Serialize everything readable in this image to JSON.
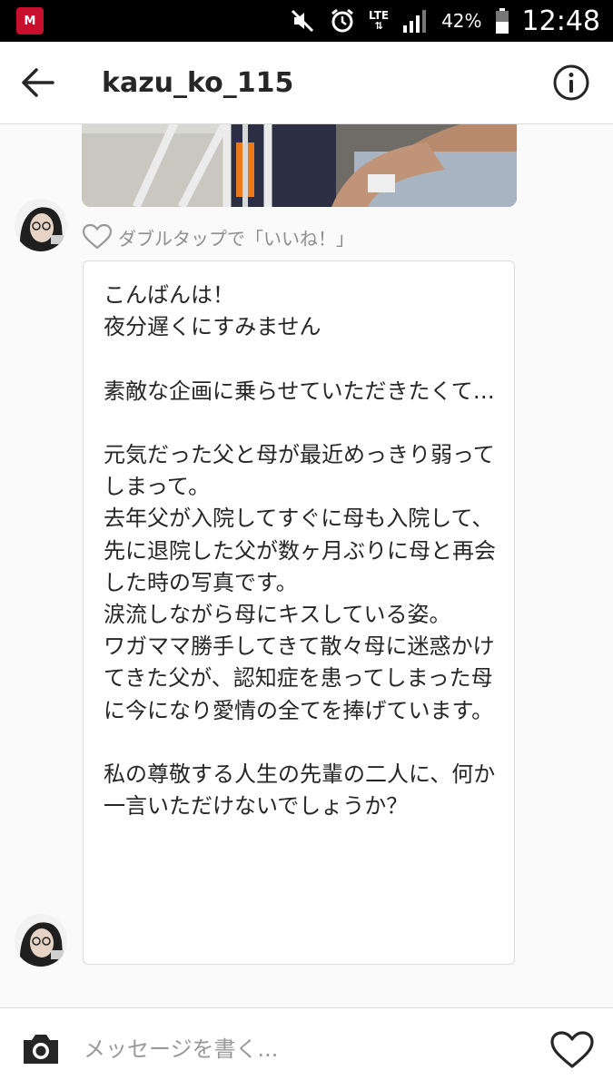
{
  "status_bar": {
    "network": "LTE",
    "battery": "42%",
    "time": "12:48"
  },
  "header": {
    "username": "kazu_ko_115"
  },
  "conversation": {
    "like_hint": "ダブルタップで「いいね！」",
    "message_text": "こんばんは！\n夜分遅くにすみません\n\n素敵な企画に乗らせていただきたくて…\n\n元気だった父と母が最近めっきり弱ってしまって。\n去年父が入院してすぐに母も入院して、先に退院した父が数ヶ月ぶりに母と再会した時の写真です。\n涙流しながら母にキスしている姿。\nワガママ勝手してきて散々母に迷惑かけてきた父が、認知症を患ってしまった母に今になり愛情の全てを捧げています。\n\n私の尊敬する人生の先輩の二人に、何か一言いただけないでしょうか？"
  },
  "composer": {
    "placeholder": "メッセージを書く..."
  },
  "colors": {
    "text": "#262626",
    "muted": "#8e8e8e",
    "border": "#dbdbdb"
  }
}
